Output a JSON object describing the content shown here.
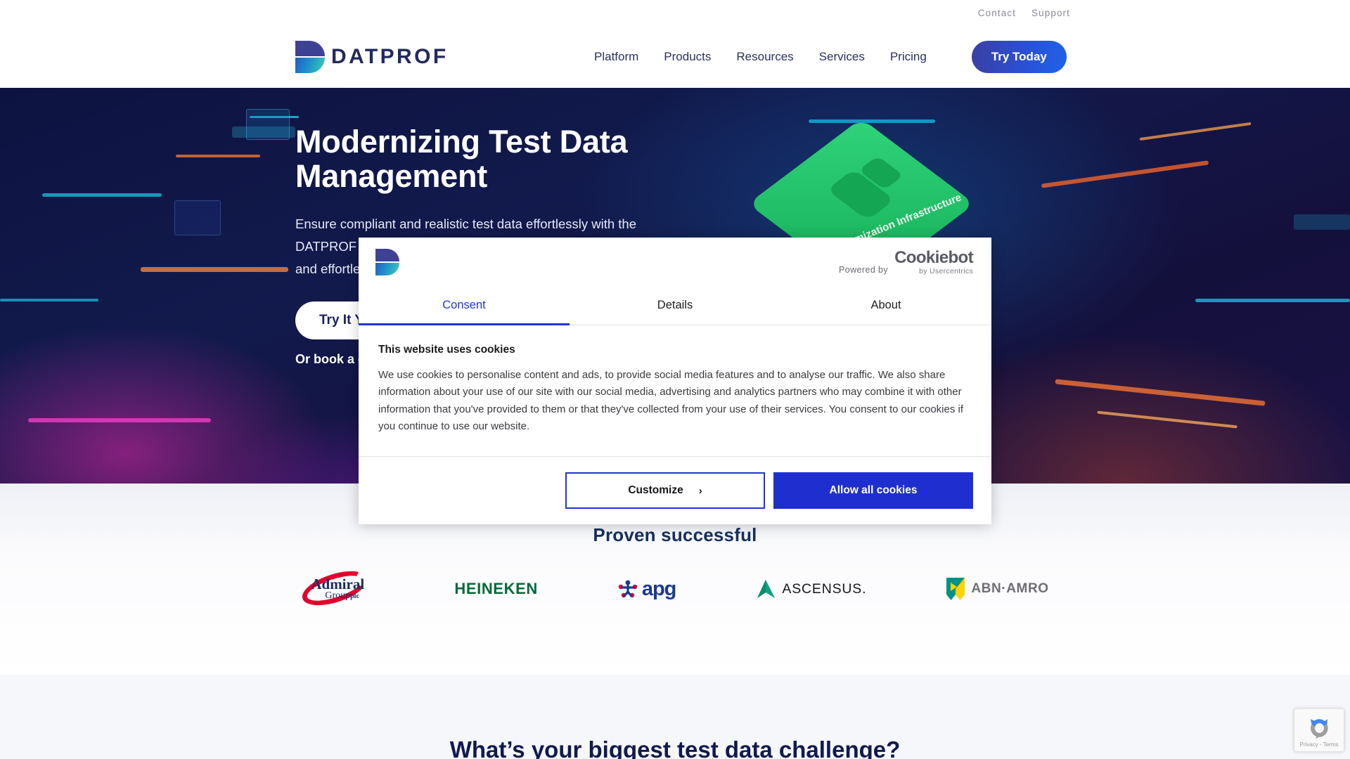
{
  "utility": {
    "links": [
      {
        "label": "Contact",
        "name": "contact"
      },
      {
        "label": "Support",
        "name": "support"
      }
    ]
  },
  "brand": {
    "name": "DATPROF",
    "logo_icon": "datprof-d-logo-icon",
    "colors": {
      "indigo": "#3d4296",
      "teal": "#3fd2ae",
      "navy": "#222a5c"
    }
  },
  "nav": {
    "links": [
      {
        "label": "Platform"
      },
      {
        "label": "Products"
      },
      {
        "label": "Resources"
      },
      {
        "label": "Services"
      },
      {
        "label": "Pricing"
      }
    ],
    "cta_label": "Try Today",
    "cta_color": "#2b4fd4"
  },
  "hero": {
    "title": "Modernizing Test Data Management",
    "paragraph": "Ensure compliant and realistic test data effortlessly with the DATPROF Test Data Platform. Take control of your test data and effortlessly provide data sets tailored to your needs.",
    "cta_label": "Try It Yourself",
    "sub_label": "Or book a demo",
    "art_label": "Anonymization Infrastructure",
    "art_icon": "green-cube-icon"
  },
  "cookie_dialog": {
    "logo_icon": "datprof-d-logo-icon",
    "powered_by_label": "Powered by",
    "provider_name": "Cookiebot",
    "provider_sub": "by Usercentrics",
    "tabs": [
      {
        "label": "Consent",
        "active": true
      },
      {
        "label": "Details",
        "active": false
      },
      {
        "label": "About",
        "active": false
      }
    ],
    "body_title": "This website uses cookies",
    "body_text": "We use cookies to personalise content and ads, to provide social media features and to analyse our traffic. We also share information about your use of our site with our social media, advertising and analytics partners who may combine it with other information that you've provided to them or that they've collected from your use of their services. You consent to our cookies if you continue to use our website.",
    "customize_label": "Customize",
    "customize_chevron": "›",
    "allow_all_label": "Allow all cookies",
    "accent_color": "#1f35d6"
  },
  "proven": {
    "title": "Proven successful",
    "clients": [
      {
        "name": "Admiral Group plc",
        "text": "Admiral",
        "sub": "Group",
        "suffix": "plc",
        "icon": "admiral-logo-icon"
      },
      {
        "name": "Heineken",
        "text": "HEINEKEN",
        "icon": "heineken-logo-icon"
      },
      {
        "name": "apg",
        "text": "apg",
        "icon": "apg-logo-icon"
      },
      {
        "name": "Ascensus",
        "text": "ASCENSUS.",
        "icon": "ascensus-logo-icon"
      },
      {
        "name": "ABN AMRO",
        "text": "ABN·AMRO",
        "icon": "abnamro-logo-icon"
      }
    ]
  },
  "bottom": {
    "title": "What’s your biggest test data challenge?"
  },
  "recaptcha": {
    "label": "Privacy - Terms",
    "icon": "recaptcha-icon"
  }
}
